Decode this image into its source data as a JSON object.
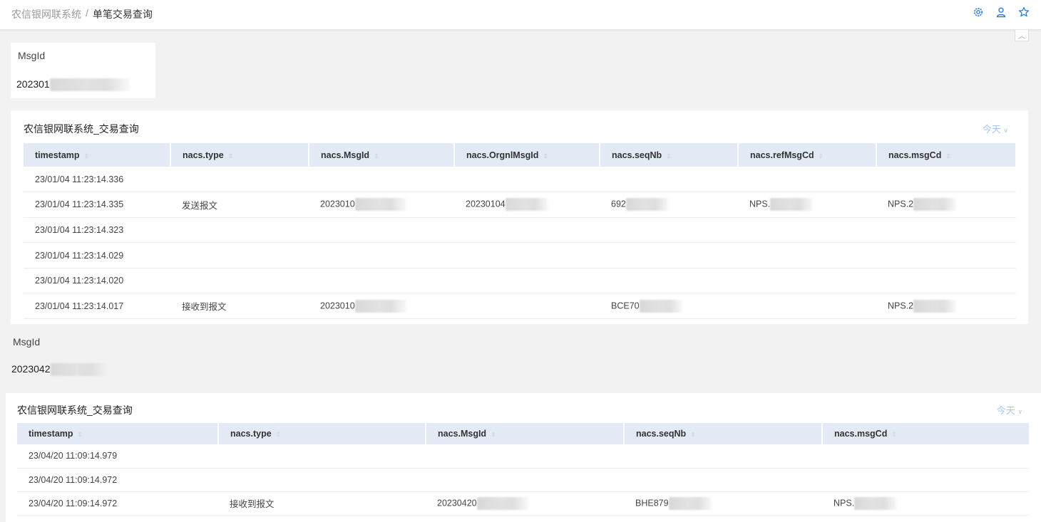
{
  "breadcrumb": {
    "root": "农信银网联系统",
    "separator": "/",
    "current": "单笔交易查询"
  },
  "icons": [
    "gear-icon",
    "user-icon",
    "star-icon"
  ],
  "accent_color": "#2f7cd8",
  "section1": {
    "msgid_label": "MsgId",
    "msgid_value": "202301",
    "panel_title": "农信银网联系统_交易查询",
    "date_filter": "今天",
    "columns": [
      "timestamp",
      "nacs.type",
      "nacs.MsgId",
      "nacs.OrgnlMsgId",
      "nacs.seqNb",
      "nacs.refMsgCd",
      "nacs.msgCd"
    ],
    "rows": [
      [
        "23/01/04 11:23:14.336",
        "",
        "",
        "",
        "",
        "",
        ""
      ],
      [
        "23/01/04 11:23:14.335",
        "发送报文",
        "2023010",
        "20230104",
        "692",
        "NPS.",
        "NPS.2"
      ],
      [
        "23/01/04 11:23:14.323",
        "",
        "",
        "",
        "",
        "",
        ""
      ],
      [
        "23/01/04 11:23:14.029",
        "",
        "",
        "",
        "",
        "",
        ""
      ],
      [
        "23/01/04 11:23:14.020",
        "",
        "",
        "",
        "",
        "",
        ""
      ],
      [
        "23/01/04 11:23:14.017",
        "接收到报文",
        "2023010",
        "",
        "BCE70",
        "",
        "NPS.2"
      ]
    ]
  },
  "section2": {
    "msgid_label": "MsgId",
    "msgid_value": "2023042",
    "panel_title": "农信银网联系统_交易查询",
    "date_filter": "今天",
    "columns": [
      "timestamp",
      "nacs.type",
      "nacs.MsgId",
      "nacs.seqNb",
      "nacs.msgCd"
    ],
    "rows": [
      [
        "23/04/20 11:09:14.979",
        "",
        "",
        "",
        ""
      ],
      [
        "23/04/20 11:09:14.972",
        "",
        "",
        "",
        ""
      ],
      [
        "23/04/20 11:09:14.972",
        "接收到报文",
        "20230420",
        "BHE879",
        "NPS."
      ]
    ]
  }
}
